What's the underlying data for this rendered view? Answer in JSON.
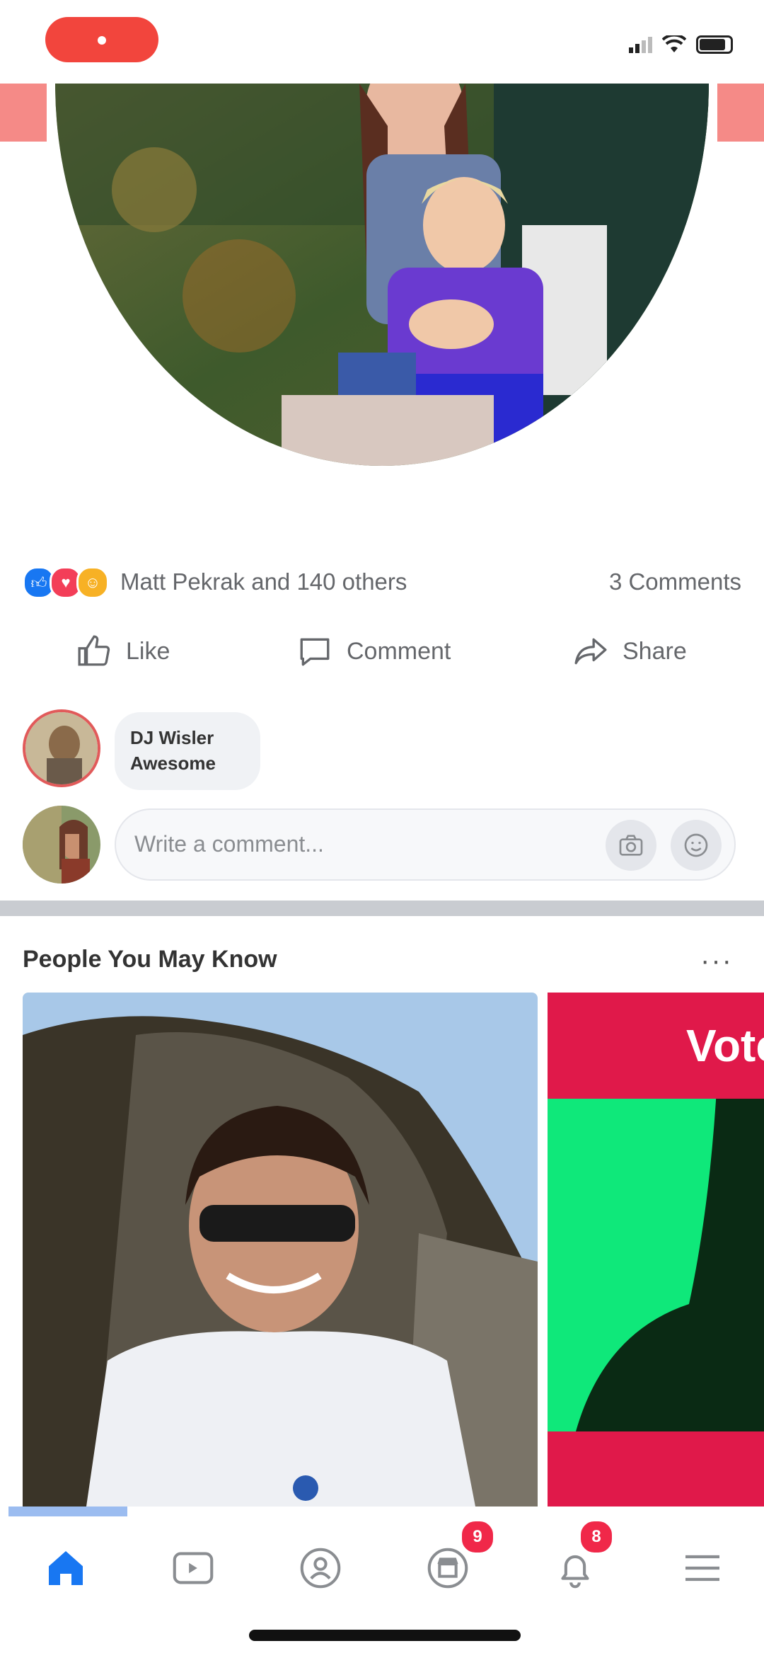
{
  "status_bar": {
    "recording_indicator": "record-dot-icon"
  },
  "post": {
    "reactions": [
      "like",
      "love",
      "haha"
    ],
    "reactions_text": "Matt Pekrak and 140 others",
    "comments_count": "3 Comments",
    "actions": {
      "like": "Like",
      "comment": "Comment",
      "share": "Share"
    }
  },
  "comment": {
    "author": "DJ Wisler",
    "text": "Awesome"
  },
  "write_comment": {
    "placeholder": "Write a comment..."
  },
  "pymk": {
    "title": "People You May Know",
    "more": "···",
    "card2_header": "Vote"
  },
  "nav": {
    "items": [
      "home-icon",
      "watch-icon",
      "groups-icon",
      "marketplace-icon",
      "notifications-icon",
      "menu-icon"
    ],
    "marketplace_badge": "9",
    "notifications_badge": "8"
  },
  "colors": {
    "accent": "#1877f2",
    "badge": "#f02849",
    "record": "#f2453d"
  }
}
